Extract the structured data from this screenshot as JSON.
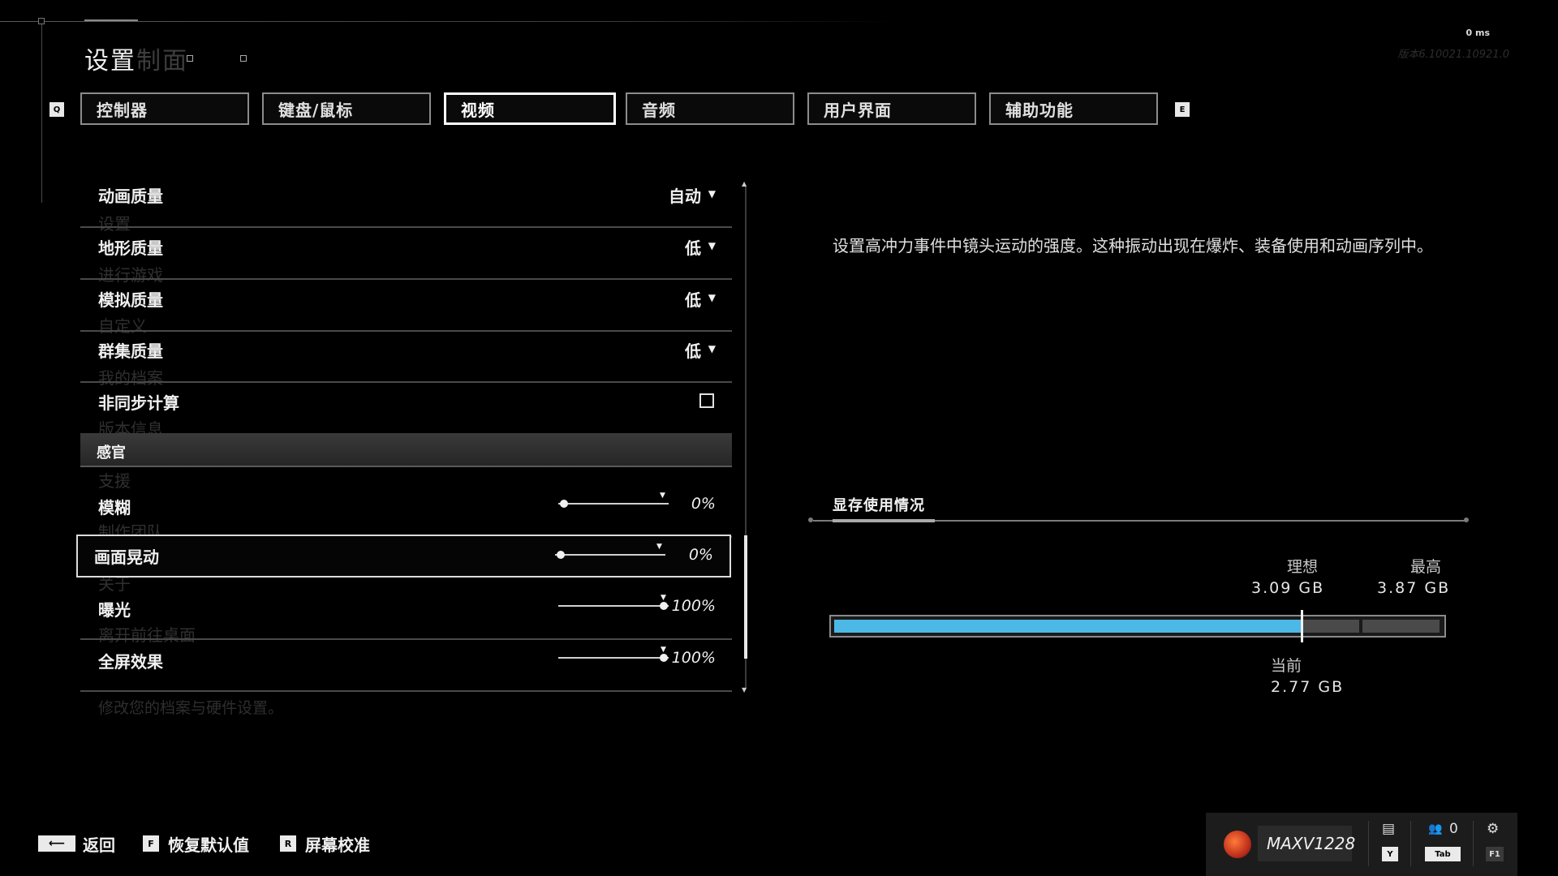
{
  "header": {
    "title": "设置",
    "title_ghost": "制面",
    "ping": "0 ms",
    "version": "版本6.10021.10921.0"
  },
  "tabs": {
    "prev_key": "Q",
    "next_key": "E",
    "items": [
      {
        "label": "控制器"
      },
      {
        "label": "键盘/鼠标"
      },
      {
        "label": "视频",
        "active": true
      },
      {
        "label": "音频"
      },
      {
        "label": "用户界面"
      },
      {
        "label": "辅助功能"
      }
    ]
  },
  "background_menu": [
    "设置",
    "进行游戏",
    "自定义",
    "我的档案",
    "版本信息",
    "支援",
    "制作团队",
    "关于",
    "离开前往桌面"
  ],
  "settings": {
    "animation_quality": {
      "label": "动画质量",
      "value": "自动"
    },
    "terrain_quality": {
      "label": "地形质量",
      "value": "低"
    },
    "simulation_quality": {
      "label": "模拟质量",
      "value": "低"
    },
    "crowd_quality": {
      "label": "群集质量",
      "value": "低"
    },
    "async_compute": {
      "label": "非同步计算",
      "checked": false
    },
    "section_senses": "感官",
    "blur": {
      "label": "模糊",
      "value": "0%",
      "level": 0
    },
    "screen_shake": {
      "label": "画面晃动",
      "value": "0%",
      "level": 0
    },
    "exposure": {
      "label": "曝光",
      "value": "100%",
      "level": 100
    },
    "fullscreen_effects": {
      "label": "全屏效果",
      "value": "100%",
      "level": 100
    }
  },
  "hint": "修改您的档案与硬件设置。",
  "description": "设置高冲力事件中镜头运动的强度。这种振动出现在爆炸、装备使用和动画序列中。",
  "vram": {
    "title": "显存使用情况",
    "ideal_label": "理想",
    "ideal_value": "3.09 GB",
    "max_label": "最高",
    "max_value": "3.87 GB",
    "current_label": "当前",
    "current_value": "2.77 GB",
    "current_gb": 2.77,
    "ideal_gb": 3.09,
    "max_gb": 3.87,
    "bar_color": "#4cb8e6"
  },
  "footer": {
    "back_label": "返回",
    "reset_key": "F",
    "reset_label": "恢复默认值",
    "calibrate_key": "R",
    "calibrate_label": "屏幕校准",
    "gamertag": "MAXV1228",
    "chat_key": "Y",
    "friends_count": "0",
    "friends_key": "Tab",
    "settings_key": "F1"
  }
}
